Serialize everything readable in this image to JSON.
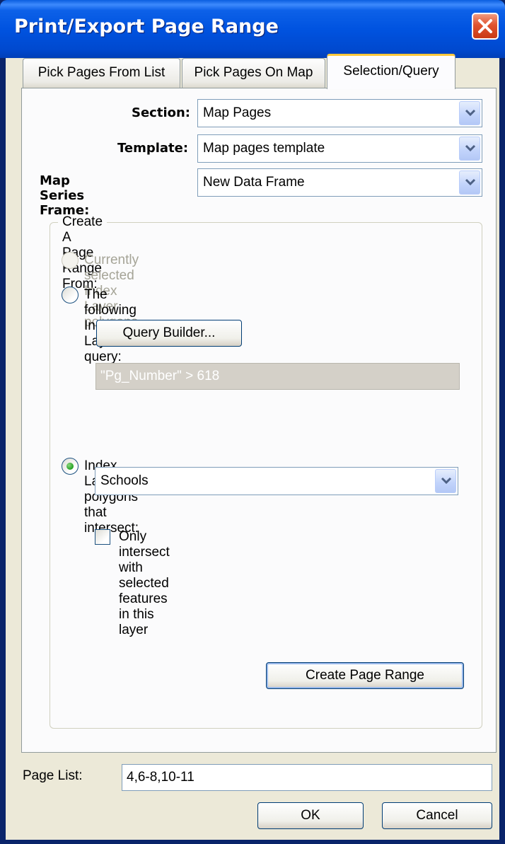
{
  "window": {
    "title": "Print/Export Page Range",
    "close_icon": "close-icon"
  },
  "tabs": [
    {
      "label": "Pick Pages From List",
      "active": false
    },
    {
      "label": "Pick Pages On Map",
      "active": false
    },
    {
      "label": "Selection/Query",
      "active": true
    }
  ],
  "form": {
    "section_label": "Section:",
    "section_value": "Map Pages",
    "template_label": "Template:",
    "template_value": "Map pages template",
    "frame_label": "Map Series Frame:",
    "frame_value": "New Data Frame"
  },
  "group": {
    "title": "Create A Page Range From:",
    "option_selected_label": "Currently selected Index Layer polygons",
    "option_query_label": "The following Index Layer query:",
    "query_builder_label": "Query Builder...",
    "query_expression": "\"Pg_Number\" > 618",
    "option_intersect_label": "Index Layer polygons that intersect:",
    "intersect_layer": "Schools",
    "only_selected_label": "Only intersect with selected features in this layer",
    "create_button": "Create Page Range"
  },
  "footer": {
    "page_list_label": "Page List:",
    "page_list_value": "4,6-8,10-11",
    "ok_label": "OK",
    "cancel_label": "Cancel"
  },
  "colors": {
    "titlebar": "#0053e0",
    "dialog_bg": "#ece9d8",
    "tab_highlight": "#ffc83c",
    "radio_selected": "#21a121"
  }
}
